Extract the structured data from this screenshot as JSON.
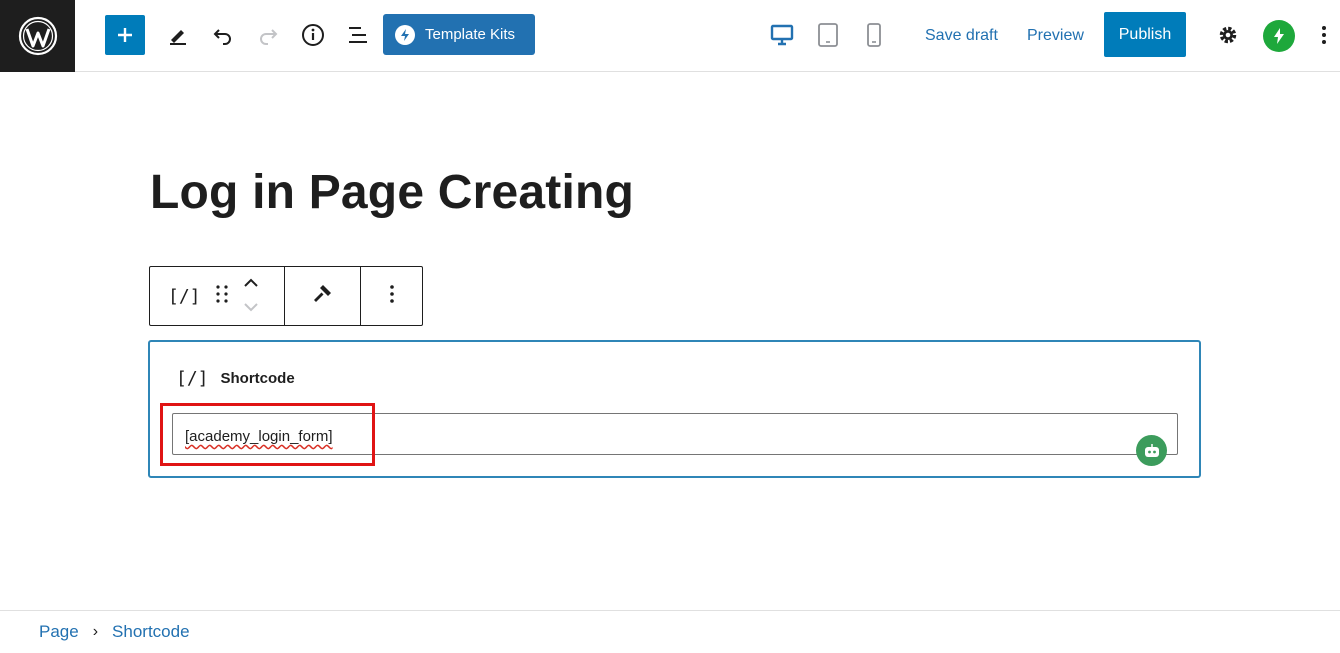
{
  "toolbar": {
    "template_kits_label": "Template Kits",
    "save_draft_label": "Save draft",
    "preview_label": "Preview",
    "publish_label": "Publish"
  },
  "editor": {
    "title": "Log in Page Creating",
    "block": {
      "glyph": "[/]",
      "label": "Shortcode",
      "value": "[academy_login_form]"
    },
    "block_toolbar": {
      "type_glyph": "[/]"
    }
  },
  "breadcrumb": {
    "items": [
      "Page",
      "Shortcode"
    ],
    "separator": "›"
  },
  "colors": {
    "accent": "#007cba",
    "highlight": "#e01414",
    "jetpack": "#1ea83b"
  }
}
